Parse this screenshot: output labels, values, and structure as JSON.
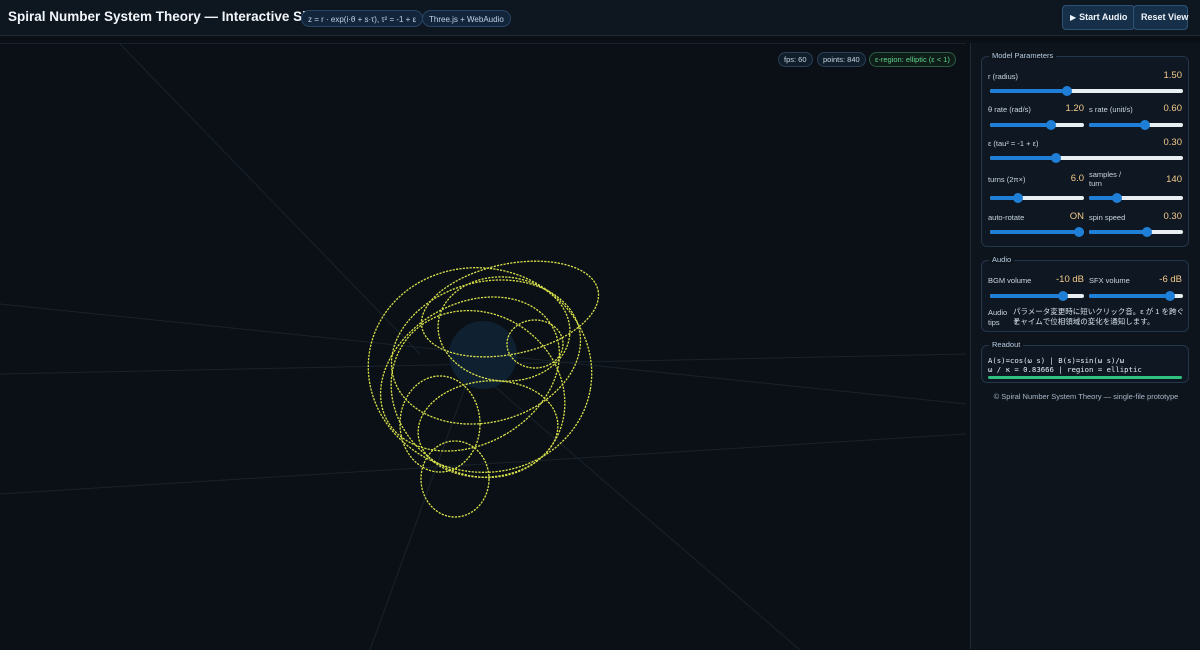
{
  "header": {
    "title": "Spiral Number System Theory — Interactive Simulator",
    "formula": "z = r · exp(i·θ + s·τ), τ² = -1 + ε",
    "tech": "Three.js + WebAudio",
    "start_audio": "Start Audio",
    "start_audio_icon": "play-icon",
    "reset_view": "Reset View"
  },
  "viewport": {
    "fps": "fps: 60",
    "points": "points: 840",
    "region": "ε-region: elliptic (ε < 1)",
    "curve_color": "#d7e04a"
  },
  "model": {
    "legend": "Model Parameters",
    "r_label": "r (radius)",
    "r_value": "1.50",
    "r_level": 0.4,
    "theta_label": "θ rate (rad/s)",
    "theta_value": "1.20",
    "theta_level": 0.65,
    "s_label": "s rate (unit/s)",
    "s_value": "0.60",
    "s_level": 0.6,
    "eps_label": "ε (tau² = -1 + ε)",
    "eps_value": "0.30",
    "eps_level": 0.34,
    "turns_label": "turns (2π×)",
    "turns_value": "6.0",
    "turns_level": 0.3,
    "samples_label_1": "samples /",
    "samples_label_2": "turn",
    "samples_value": "140",
    "samples_level": 0.3,
    "autorotate_label": "auto-rotate",
    "autorotate_value": "ON",
    "autorotate_level": 0.95,
    "spin_label": "spin speed",
    "spin_value": "0.30",
    "spin_level": 0.62
  },
  "audio": {
    "legend": "Audio",
    "bgm_label": "BGM volume",
    "bgm_value": "-10 dB",
    "bgm_level": 0.78,
    "sfx_label": "SFX volume",
    "sfx_value": "-6 dB",
    "sfx_level": 0.86,
    "tips_label_1": "Audio",
    "tips_label_2": "tips",
    "tips_text_1": "パラメータ変更時に短いクリック音。ε が 1 を跨ぐと",
    "tips_text_2": "チャイムで位相領域の変化を通知します。"
  },
  "readout": {
    "legend": "Readout",
    "line1": "A(s)=cos(ω s) | B(s)=sin(ω s)/ω",
    "line2": "ω / κ = 0.83666 | region = elliptic",
    "bar_color": "#2ec27e"
  },
  "footer": "© Spiral Number System Theory — single-file prototype"
}
